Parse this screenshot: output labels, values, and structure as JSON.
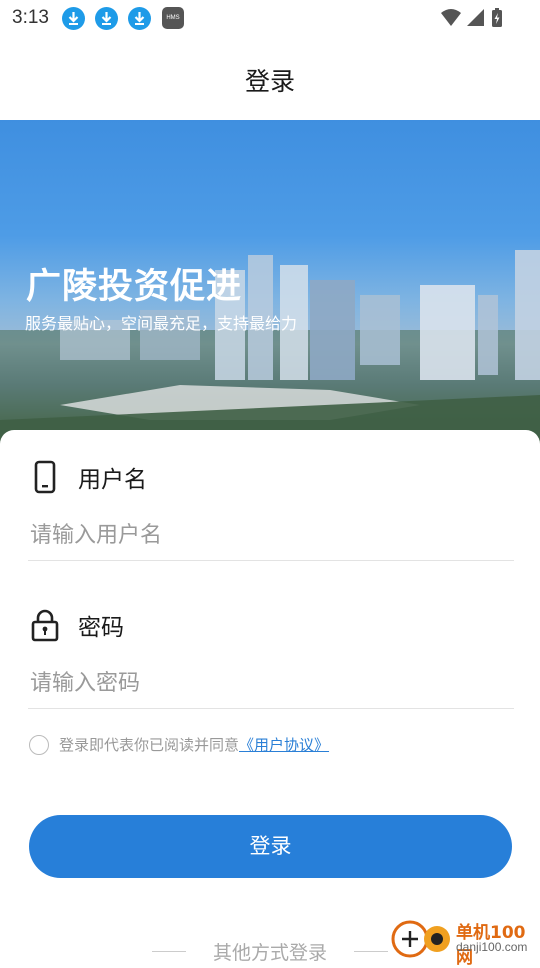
{
  "status_bar": {
    "time": "3:13",
    "notification_icons": [
      "download-icon",
      "download-icon",
      "download-icon",
      "hms-icon"
    ],
    "hms_label": "HMS",
    "system_icons": [
      "wifi-icon",
      "signal-icon",
      "battery-charging-icon"
    ]
  },
  "header": {
    "title": "登录"
  },
  "banner": {
    "title": "广陵投资促进",
    "subtitle": "服务最贴心，空间最充足，支持最给力"
  },
  "form": {
    "username": {
      "label": "用户名",
      "placeholder": "请输入用户名",
      "icon": "phone-icon"
    },
    "password": {
      "label": "密码",
      "placeholder": "请输入密码",
      "icon": "lock-icon"
    },
    "agreement": {
      "text": "登录即代表你已阅读并同意",
      "link": "《用户协议》",
      "checked": false
    },
    "login_button": "登录",
    "other_login": "其他方式登录"
  },
  "watermark": {
    "line1": "单机100网",
    "line2": "danji100.com"
  },
  "colors": {
    "primary": "#277fd9",
    "link": "#2a7fd6",
    "placeholder": "#9a9a9a"
  }
}
